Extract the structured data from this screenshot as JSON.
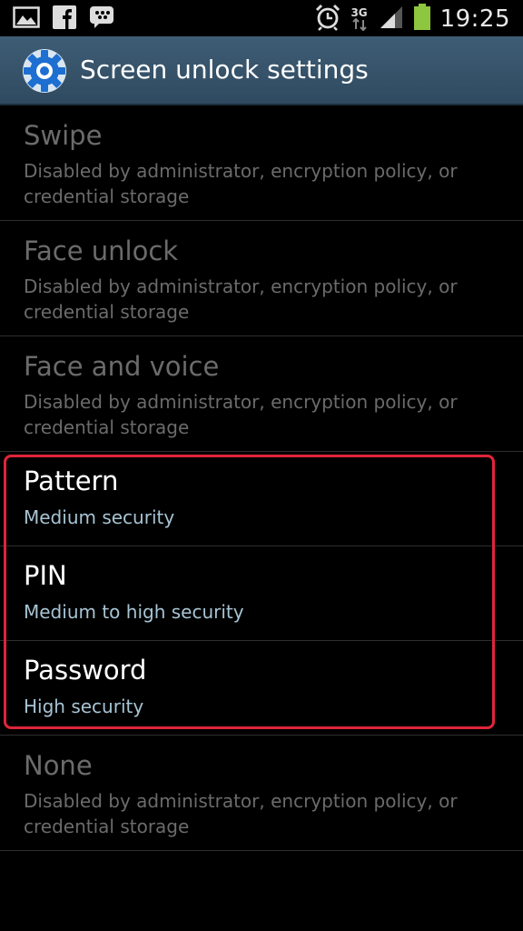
{
  "status_bar": {
    "network": "3G",
    "time": "19:25",
    "icons": [
      "gallery-icon",
      "facebook-icon",
      "messenger-icon",
      "alarm-icon",
      "signal-icon",
      "battery-icon"
    ]
  },
  "action_bar": {
    "title": "Screen unlock settings",
    "icon": "settings-gear-icon"
  },
  "options": [
    {
      "title": "Swipe",
      "summary": "Disabled by administrator, encryption policy, or credential storage",
      "enabled": false
    },
    {
      "title": "Face unlock",
      "summary": "Disabled by administrator, encryption policy, or credential storage",
      "enabled": false
    },
    {
      "title": "Face and voice",
      "summary": "Disabled by administrator, encryption policy, or credential storage",
      "enabled": false
    },
    {
      "title": "Pattern",
      "summary": "Medium security",
      "enabled": true
    },
    {
      "title": "PIN",
      "summary": "Medium to high security",
      "enabled": true
    },
    {
      "title": "Password",
      "summary": "High security",
      "enabled": true
    },
    {
      "title": "None",
      "summary": "Disabled by administrator, encryption policy, or credential storage",
      "enabled": false
    }
  ],
  "colors": {
    "action_bar": "#35526a",
    "disabled_text": "#6b6b6b",
    "enabled_summary": "#a7c4d4",
    "highlight": "#e0253a",
    "battery": "#8dc63f"
  }
}
